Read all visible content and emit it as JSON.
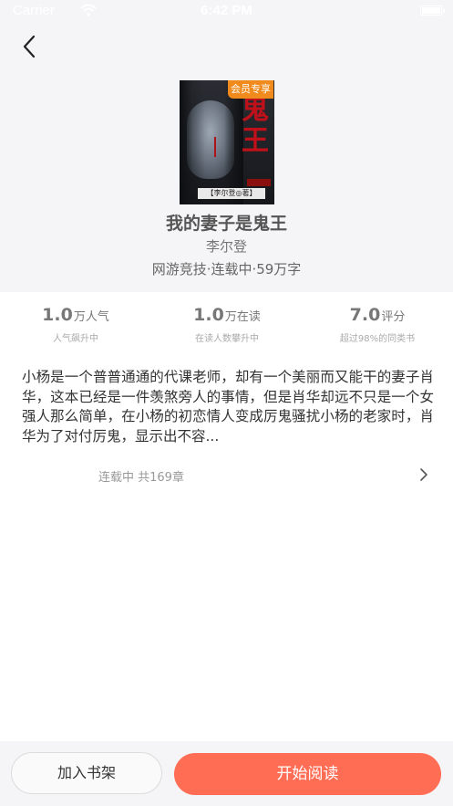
{
  "status_bar": {
    "carrier": "Carrier",
    "time": "6:42 PM",
    "wifi_icon": "wifi-icon",
    "battery_icon": "battery-icon"
  },
  "nav": {
    "back_icon": "chevron-left-icon"
  },
  "book": {
    "badge": "会员专享",
    "cover_title_art": "鬼王",
    "cover_author": "【李尔登◎著】",
    "title": "我的妻子是鬼王",
    "author": "李尔登",
    "meta": "网游竞技·连载中·59万字"
  },
  "stats": [
    {
      "value": "1.0",
      "unit": "万人气",
      "caption": "人气飙升中"
    },
    {
      "value": "1.0",
      "unit": "万在读",
      "caption": "在读人数攀升中"
    },
    {
      "value": "7.0",
      "unit": "评分",
      "caption": "超过98%的同类书"
    }
  ],
  "synopsis": "小杨是一个普普通通的代课老师，却有一个美丽而又能干的妻子肖华，这本已经是一件羡煞旁人的事情，但是肖华却远不只是一个女强人那么简单，在小杨的初恋情人变成厉鬼骚扰小杨的老家时，肖华为了对付厉鬼，显示出不容...",
  "chapters": {
    "label": "连载中 共169章",
    "arrow_icon": "chevron-right-icon"
  },
  "actions": {
    "add_to_shelf": "加入书架",
    "start_reading": "开始阅读"
  },
  "colors": {
    "accent": "#ff6d55",
    "badge": "#f08a1c",
    "header_bg": "#f5f5f7"
  }
}
